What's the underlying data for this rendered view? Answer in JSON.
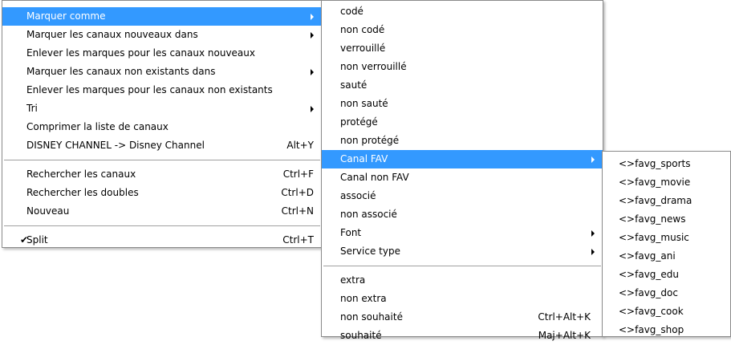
{
  "menu_main": {
    "group1": [
      {
        "label": "Marquer comme",
        "shortcut": "",
        "submenu": true,
        "highlighted": true
      },
      {
        "label": "Marquer les canaux nouveaux dans",
        "shortcut": "",
        "submenu": true
      },
      {
        "label": "Enlever les marques pour les canaux nouveaux",
        "shortcut": "",
        "submenu": false
      },
      {
        "label": "Marquer les canaux non existants dans",
        "shortcut": "",
        "submenu": true
      },
      {
        "label": "Enlever les marques pour les canaux non existants",
        "shortcut": "",
        "submenu": false
      },
      {
        "label": "Tri",
        "shortcut": "",
        "submenu": true
      },
      {
        "label": "Comprimer la liste de canaux",
        "shortcut": "",
        "submenu": false
      },
      {
        "label": "DISNEY CHANNEL -> Disney Channel",
        "shortcut": "Alt+Y",
        "submenu": false
      }
    ],
    "group2": [
      {
        "label": "Rechercher les canaux",
        "shortcut": "Ctrl+F"
      },
      {
        "label": "Rechercher les doubles",
        "shortcut": "Ctrl+D"
      },
      {
        "label": "Nouveau",
        "shortcut": "Ctrl+N"
      }
    ],
    "group3": [
      {
        "label": "Split",
        "shortcut": "Ctrl+T",
        "checked": true,
        "check_glyph": "✔"
      }
    ]
  },
  "menu_mark_as": {
    "group1": [
      {
        "label": "codé",
        "shortcut": "",
        "submenu": false
      },
      {
        "label": "non codé",
        "shortcut": "",
        "submenu": false
      },
      {
        "label": "verrouillé",
        "shortcut": "",
        "submenu": false
      },
      {
        "label": "non verrouillé",
        "shortcut": "",
        "submenu": false
      },
      {
        "label": "sauté",
        "shortcut": "",
        "submenu": false
      },
      {
        "label": "non sauté",
        "shortcut": "",
        "submenu": false
      },
      {
        "label": "protégé",
        "shortcut": "",
        "submenu": false
      },
      {
        "label": "non protégé",
        "shortcut": "",
        "submenu": false
      },
      {
        "label": "Canal FAV",
        "shortcut": "",
        "submenu": true,
        "highlighted": true
      },
      {
        "label": "Canal non FAV",
        "shortcut": "",
        "submenu": false
      },
      {
        "label": "associé",
        "shortcut": "",
        "submenu": false
      },
      {
        "label": "non associé",
        "shortcut": "",
        "submenu": false
      },
      {
        "label": "Font",
        "shortcut": "",
        "submenu": true
      },
      {
        "label": "Service type",
        "shortcut": "",
        "submenu": true
      }
    ],
    "group2": [
      {
        "label": "extra",
        "shortcut": ""
      },
      {
        "label": "non extra",
        "shortcut": ""
      },
      {
        "label": "non souhaité",
        "shortcut": "Ctrl+Alt+K"
      },
      {
        "label": "souhaité",
        "shortcut": "Maj+Alt+K"
      }
    ]
  },
  "menu_fav": {
    "items": [
      {
        "label": "<>favg_sports"
      },
      {
        "label": "<>favg_movie"
      },
      {
        "label": "<>favg_drama"
      },
      {
        "label": "<>favg_news"
      },
      {
        "label": "<>favg_music"
      },
      {
        "label": "<>favg_ani"
      },
      {
        "label": "<>favg_edu"
      },
      {
        "label": "<>favg_doc"
      },
      {
        "label": "<>favg_cook"
      },
      {
        "label": "<>favg_shop"
      }
    ]
  },
  "colors": {
    "highlight": "#3399ff",
    "highlight_text": "#ffffff",
    "menu_background": "#ffffff",
    "separator": "#a0a0a0"
  }
}
